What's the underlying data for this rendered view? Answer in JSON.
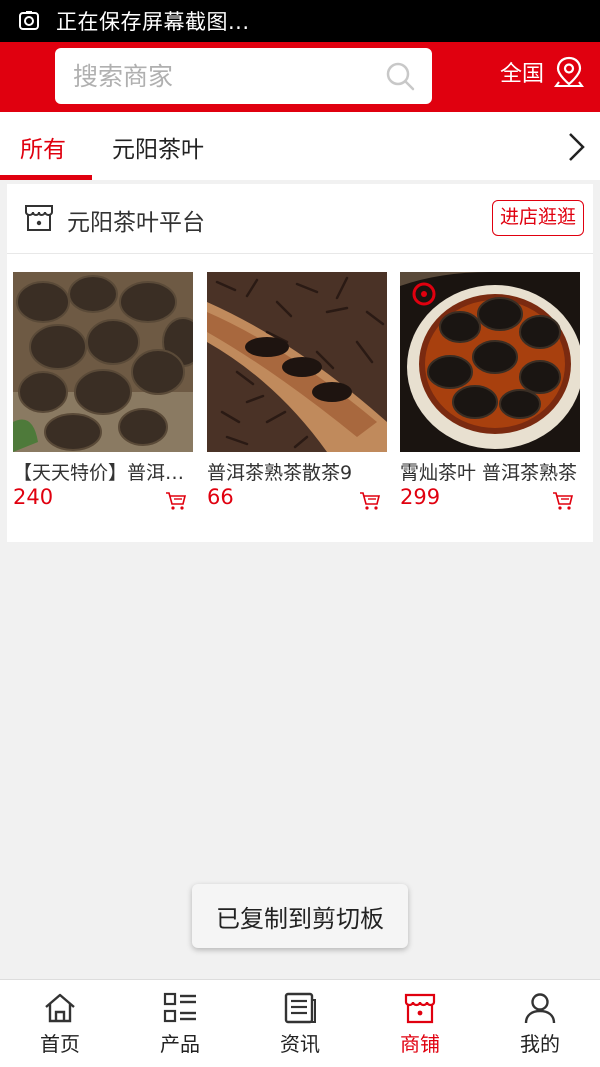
{
  "status_bar": {
    "text": "正在保存屏幕截图...",
    "icon": "screenshot-icon"
  },
  "header": {
    "search_placeholder": "搜索商家",
    "region_label": "全国",
    "colors": {
      "brand": "#e0000f"
    }
  },
  "tabs": [
    {
      "label": "所有",
      "active": true
    },
    {
      "label": "元阳茶叶",
      "active": false
    }
  ],
  "shop": {
    "name": "元阳茶叶平台",
    "enter_label": "进店逛逛",
    "products": [
      {
        "title": "【天天特价】普洱茶熟茶",
        "price": "240"
      },
      {
        "title": "普洱茶熟茶散茶9",
        "price": "66"
      },
      {
        "title": "霄灿茶叶 普洱茶熟茶",
        "price": "299"
      }
    ]
  },
  "toast": {
    "text": "已复制到剪切板"
  },
  "bottom_nav": [
    {
      "label": "首页",
      "icon": "home-icon",
      "active": false
    },
    {
      "label": "产品",
      "icon": "list-icon",
      "active": false
    },
    {
      "label": "资讯",
      "icon": "news-icon",
      "active": false
    },
    {
      "label": "商铺",
      "icon": "store-icon",
      "active": true
    },
    {
      "label": "我的",
      "icon": "user-icon",
      "active": false
    }
  ]
}
